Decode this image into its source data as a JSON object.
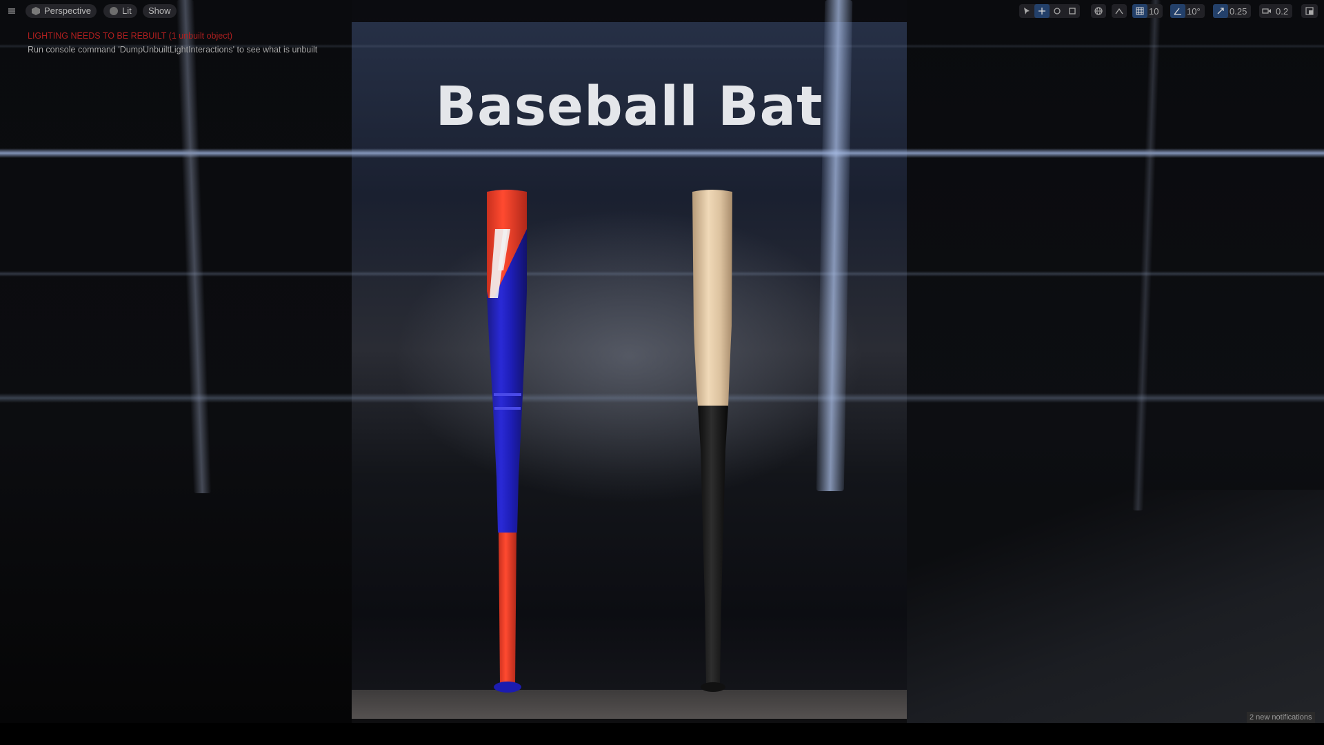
{
  "toolbar": {
    "perspective_label": "Perspective",
    "lit_label": "Lit",
    "show_label": "Show",
    "grid_snap_value": "10",
    "rotation_snap_value": "10°",
    "scale_snap_value": "0.25",
    "camera_speed_value": "0.2",
    "icons": [
      "menu-icon",
      "perspective-icon",
      "lit-icon",
      "select-icon",
      "translate-icon",
      "rotate-icon",
      "scale-icon",
      "world-icon",
      "surface-snap-icon",
      "grid-snap-icon",
      "rotation-snap-icon",
      "scale-snap-icon",
      "camera-speed-icon",
      "maximize-icon"
    ],
    "accent_color": "#23406a"
  },
  "messages": {
    "lighting_warning": "LIGHTING NEEDS TO BE REBUILT (1 unbuilt object)",
    "console_hint": "Run console command 'DumpUnbuiltLightInteractions' to see what is unbuilt"
  },
  "scene": {
    "title": "Baseball Bat"
  },
  "status": {
    "notifications": "2 new notifications"
  }
}
